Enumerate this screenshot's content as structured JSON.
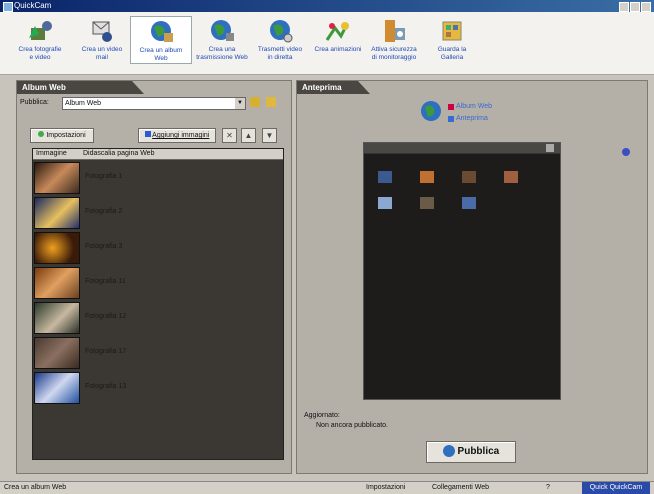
{
  "window": {
    "title": "QuickCam"
  },
  "toolbar": {
    "items": [
      {
        "label1": "Crea fotografie",
        "label2": "e video",
        "icon": "camera-photo-icon"
      },
      {
        "label1": "Crea un video",
        "label2": "mail",
        "icon": "video-mail-icon"
      },
      {
        "label1": "Crea un album",
        "label2": "Web",
        "icon": "web-album-icon",
        "active": true
      },
      {
        "label1": "Crea una",
        "label2": "trasmissione Web",
        "icon": "web-broadcast-icon"
      },
      {
        "label1": "Trasmetti video",
        "label2": "in diretta",
        "icon": "live-video-icon"
      },
      {
        "label1": "Crea animazioni",
        "label2": "",
        "icon": "animation-icon"
      },
      {
        "label1": "Attiva sicurezza",
        "label2": "di monitoraggio",
        "icon": "security-monitor-icon"
      },
      {
        "label1": "Guarda la",
        "label2": "Galleria",
        "icon": "gallery-icon"
      }
    ]
  },
  "left_panel": {
    "title": "Album Web",
    "publish_label": "Pubblica:",
    "publish_value": "Album Web",
    "settings_button": "Impostazioni",
    "add_images_button": "Aggiungi immagini",
    "columns": [
      "Immagine",
      "Didascalia pagina Web"
    ],
    "rows": [
      {
        "caption": "Fotografia 1"
      },
      {
        "caption": "Fotografia 2"
      },
      {
        "caption": "Fotografia 3"
      },
      {
        "caption": "Fotografia 11"
      },
      {
        "caption": "Fotografia 12"
      },
      {
        "caption": "Fotografia 17"
      },
      {
        "caption": "Fotografia 13"
      }
    ]
  },
  "right_panel": {
    "title": "Anteprima",
    "legend_line1": "Album Web",
    "legend_line2": "Anteprima",
    "updated_label": "Aggiornato:",
    "updated_value": "Non ancora pubblicato.",
    "publish_button": "Pubblica"
  },
  "statusbar": {
    "left": "Crea un album Web",
    "settings": "Impostazioni",
    "web_link": "Collegamenti Web",
    "help": "?",
    "app": "Quick QuickCam"
  }
}
